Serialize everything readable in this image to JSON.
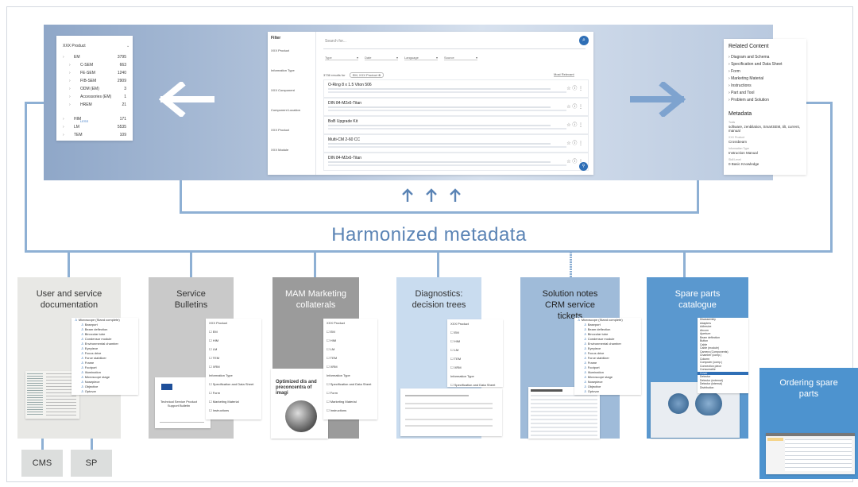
{
  "colors": {
    "accent": "#5b84b5",
    "connector": "#8eb0d4",
    "card_gray_1": "#e8e8e5",
    "card_gray_2": "#c9c9c9",
    "card_gray_3": "#9b9b9b",
    "card_blue_1": "#c9dcef",
    "card_blue_2": "#9fbbd9",
    "card_blue_3": "#5a98cf",
    "card_blue_4": "#4d93cf"
  },
  "title": "Harmonized metadata",
  "left_panel": {
    "header": "XXX Product",
    "items": [
      {
        "label": "EM",
        "count": "3795",
        "checked": false,
        "level": 0
      },
      {
        "label": "C-SEM",
        "count": "663",
        "checked": false,
        "level": 1
      },
      {
        "label": "FE-SEM",
        "count": "1240",
        "checked": false,
        "level": 1
      },
      {
        "label": "FIB-SEM",
        "count": "2909",
        "checked": false,
        "level": 1
      },
      {
        "label": "ODM (EM)",
        "count": "3",
        "checked": false,
        "level": 1
      },
      {
        "label": "Accessories (EM)",
        "count": "1",
        "checked": false,
        "level": 1
      },
      {
        "label": "HREM",
        "count": "21",
        "checked": false,
        "level": 1
      },
      {
        "label": "HIM",
        "count": "171",
        "checked": false,
        "level": 0
      },
      {
        "label": "LM",
        "count": "5535",
        "checked": false,
        "level": 0
      },
      {
        "label": "TEM",
        "count": "109",
        "checked": false,
        "level": 0
      },
      {
        "label": "XRM",
        "count": "509",
        "checked": false,
        "level": 0
      }
    ],
    "less_label": "LESS"
  },
  "center_panel": {
    "filter_label": "Filter",
    "filters": [
      "XXX Product",
      "Information Type",
      "XXX Component",
      "Component Location",
      "XXX Product",
      "XXX Module"
    ],
    "search_placeholder": "Search for...",
    "dropdowns": [
      "Type",
      "Date",
      "Language",
      "Source"
    ],
    "results_label": "3736 results for",
    "chip": "EM, XXX Product",
    "sort_label": "Most Relevant",
    "results": [
      "O-Ring 8 x 1.5 Viton 506",
      "DIN 84-M2x6-Titan",
      "BoB Upgrade Kit",
      "Multi-CM 2-60 CC",
      "DIN 84-M2x6-Titan"
    ]
  },
  "right_panel": {
    "related_title": "Related Content",
    "related_items": [
      "Diagram and Schema",
      "Specification and Data Sheet",
      "Form",
      "Marketing Material",
      "Instructions",
      "Part and Tool",
      "Problem and Solution"
    ],
    "metadata_title": "Metadata",
    "meta": [
      {
        "key": "Tools",
        "value": "software, zenbilation, SmartSEM, tilt, current, manual"
      },
      {
        "key": "XXX Product",
        "value": "Crossbeam"
      },
      {
        "key": "Information Type",
        "value": "Instruction Manual"
      },
      {
        "key": "Skill Level",
        "value": "0 Basic Knowledge"
      }
    ]
  },
  "cards": [
    {
      "title": "User and service documentation"
    },
    {
      "title": "Service Bulletins"
    },
    {
      "title": "MAM Marketing collaterals"
    },
    {
      "title": "Diagnostics: decision trees"
    },
    {
      "title": "Solution notes CRM service tickets"
    },
    {
      "title": "Spare parts catalogue"
    }
  ],
  "ordering": {
    "title": "Ordering spare parts"
  },
  "stores": [
    "CMS",
    "SP"
  ],
  "mini_tree": [
    "Microscope (Stand complete)",
    "Baseport",
    "Beam deflection",
    "Binocular tube",
    "Condensor module",
    "Environmental chamber",
    "Eyepiece",
    "Focus drive",
    "Force stabilizer",
    "Frame",
    "Footport",
    "Illumination",
    "Microscope stage",
    "Nosepiece",
    "Objective",
    "Optovar"
  ],
  "mini_filter": [
    "XXX Product",
    "EM",
    "HIM",
    "LM",
    "TEM",
    "XRM",
    "Information Type",
    "Specification and Data Sheet",
    "Form",
    "Marketing Material",
    "Instructions"
  ],
  "bulletin_doc": {
    "heading": "Technical Service Product Support Bulletin"
  },
  "mam_doc": {
    "heading": "Optimized dis and preconcentra of imagi"
  },
  "spare_list": [
    "Disassembly",
    "Adapters",
    "Adhesive",
    "Aircom",
    "Aperture",
    "Beam deflection",
    "Button",
    "Cable",
    "Cable (module)",
    "Camera (Components)",
    "Chamber (comp.)",
    "Column",
    "Computer (comp.)",
    "Connection piece",
    "Consumable",
    "Cover",
    "Detector",
    "Detector (external)",
    "Detector (internal)",
    "Distribution"
  ]
}
